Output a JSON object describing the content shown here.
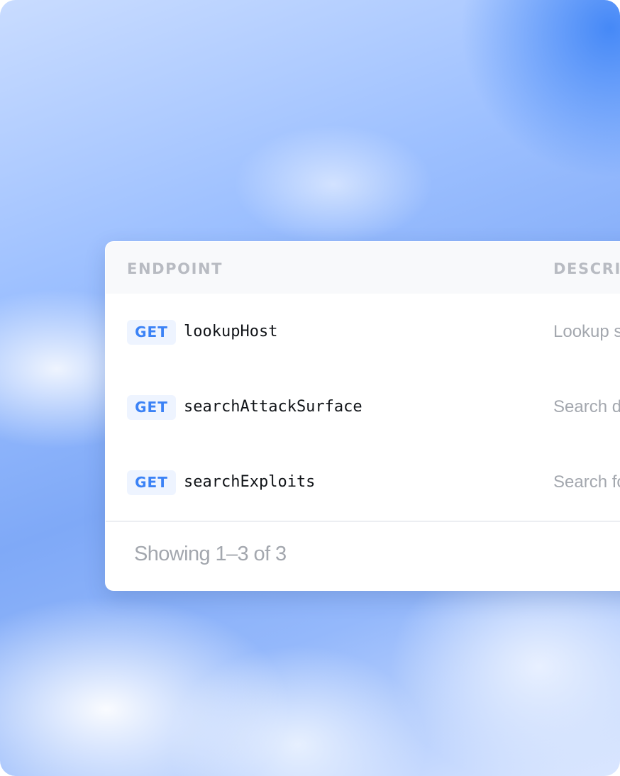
{
  "table": {
    "columns": {
      "endpoint": "ENDPOINT",
      "description": "DESCRI"
    },
    "rows": [
      {
        "method": "GET",
        "name": "lookupHost",
        "description": "Lookup s"
      },
      {
        "method": "GET",
        "name": "searchAttackSurface",
        "description": "Search d"
      },
      {
        "method": "GET",
        "name": "searchExploits",
        "description": "Search fo"
      }
    ],
    "footer": "Showing 1–3 of 3"
  },
  "colors": {
    "method_badge_text": "#3b82f6",
    "method_badge_bg": "#eef4ff",
    "muted_text": "#a3a7ae"
  }
}
